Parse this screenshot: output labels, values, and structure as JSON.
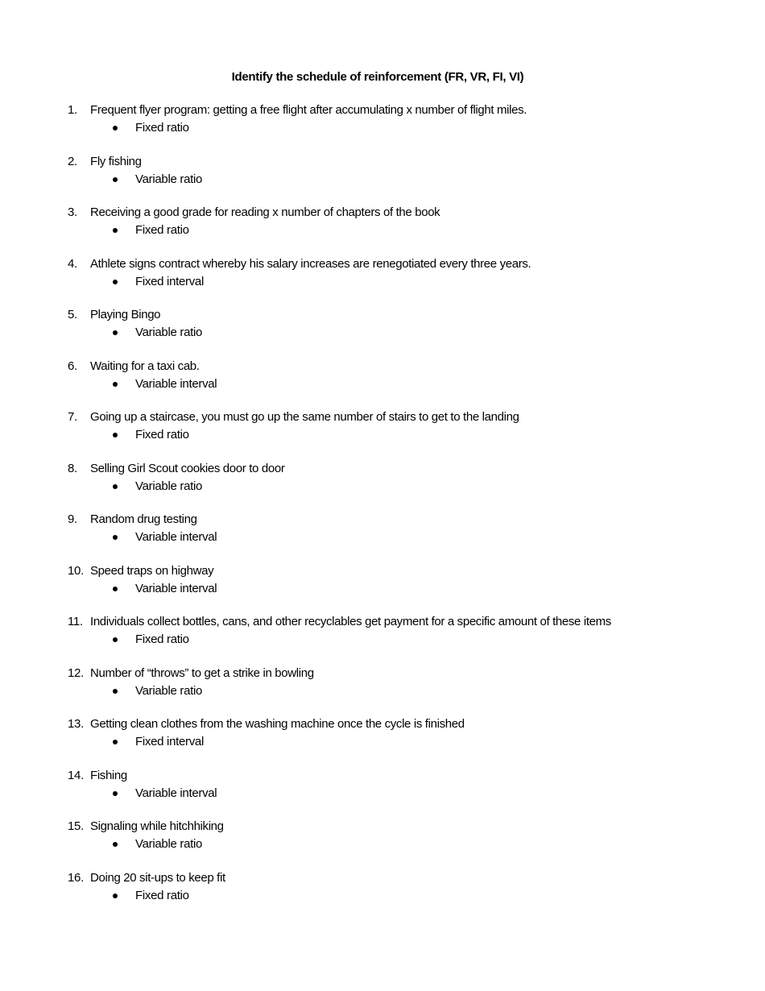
{
  "document": {
    "title": "Identify the schedule of reinforcement (FR, VR, FI, VI)",
    "items": [
      {
        "number": "1.",
        "question": "Frequent flyer program: getting a free flight after accumulating x number of flight miles.",
        "answer": "Fixed ratio"
      },
      {
        "number": "2.",
        "question": "Fly fishing",
        "answer": "Variable ratio"
      },
      {
        "number": "3.",
        "question": "Receiving a good grade for reading x number of chapters of the book",
        "answer": "Fixed ratio"
      },
      {
        "number": "4.",
        "question": "Athlete signs contract whereby his salary increases are renegotiated every three years.",
        "answer": "Fixed interval"
      },
      {
        "number": "5.",
        "question": "Playing Bingo",
        "answer": "Variable ratio"
      },
      {
        "number": "6.",
        "question": "Waiting for a taxi cab.",
        "answer": "Variable interval"
      },
      {
        "number": "7.",
        "question": "Going up a staircase, you must go up the same number of stairs to get to the landing",
        "answer": "Fixed ratio"
      },
      {
        "number": "8.",
        "question": "Selling Girl Scout cookies door to door",
        "answer": "Variable ratio"
      },
      {
        "number": "9.",
        "question": "Random drug testing",
        "answer": "Variable interval"
      },
      {
        "number": "10.",
        "question": "Speed traps on highway",
        "answer": "Variable interval"
      },
      {
        "number": "11.",
        "question": "Individuals collect bottles, cans, and other recyclables get payment for a specific amount of these items",
        "answer": "Fixed ratio"
      },
      {
        "number": "12.",
        "question": "Number of “throws” to get a strike in bowling",
        "answer": "Variable ratio"
      },
      {
        "number": "13.",
        "question": "Getting clean clothes from the washing machine once the cycle is finished",
        "answer": "Fixed interval"
      },
      {
        "number": "14.",
        "question": "Fishing",
        "answer": "Variable interval"
      },
      {
        "number": "15.",
        "question": "Signaling while hitchhiking",
        "answer": "Variable ratio"
      },
      {
        "number": "16.",
        "question": "Doing 20 sit-ups to keep fit",
        "answer": "Fixed ratio"
      }
    ]
  }
}
